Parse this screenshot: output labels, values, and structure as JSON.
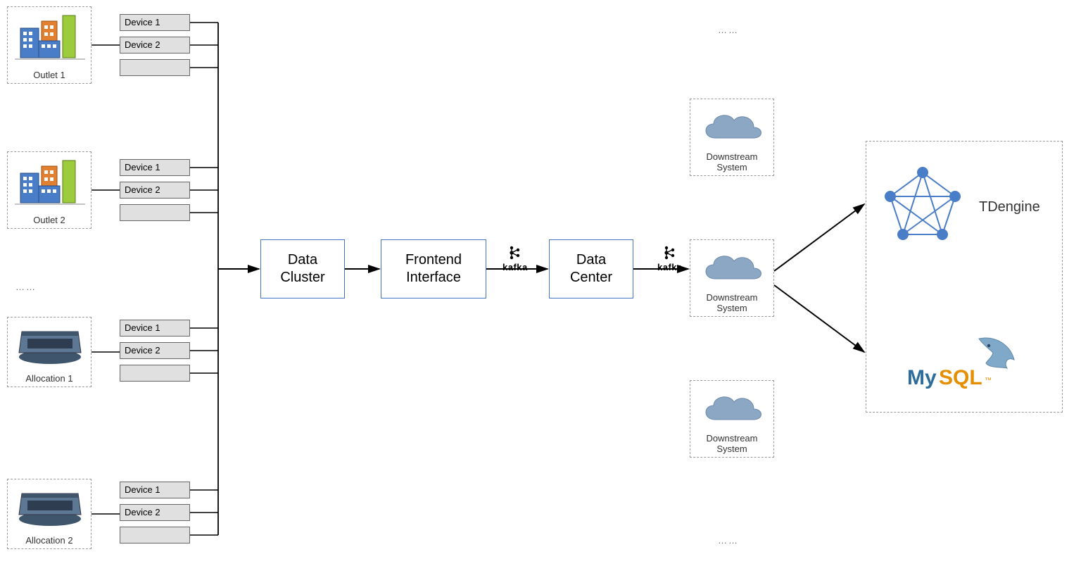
{
  "sources": {
    "outlet1": {
      "label": "Outlet 1",
      "devices": [
        "Device 1",
        "Device 2",
        ""
      ]
    },
    "outlet2": {
      "label": "Outlet 2",
      "devices": [
        "Device 1",
        "Device 2",
        ""
      ]
    },
    "alloc1": {
      "label": "Allocation 1",
      "devices": [
        "Device 1",
        "Device 2",
        ""
      ]
    },
    "alloc2": {
      "label": "Allocation 2",
      "devices": [
        "Device 1",
        "Device 2",
        ""
      ]
    },
    "ellipsis": "……"
  },
  "pipeline": {
    "cluster": "Data\nCluster",
    "frontend": "Frontend\nInterface",
    "center": "Data\nCenter",
    "edge1": "kafka",
    "edge2": "kafka"
  },
  "downstream": {
    "sys1": "Downstream System",
    "sys2": "Downstream System",
    "sys3": "Downstream System",
    "top_ellipsis": "……",
    "bot_ellipsis": "……"
  },
  "sinks": {
    "tdengine": "TDengine",
    "mysql": "MySQL"
  }
}
